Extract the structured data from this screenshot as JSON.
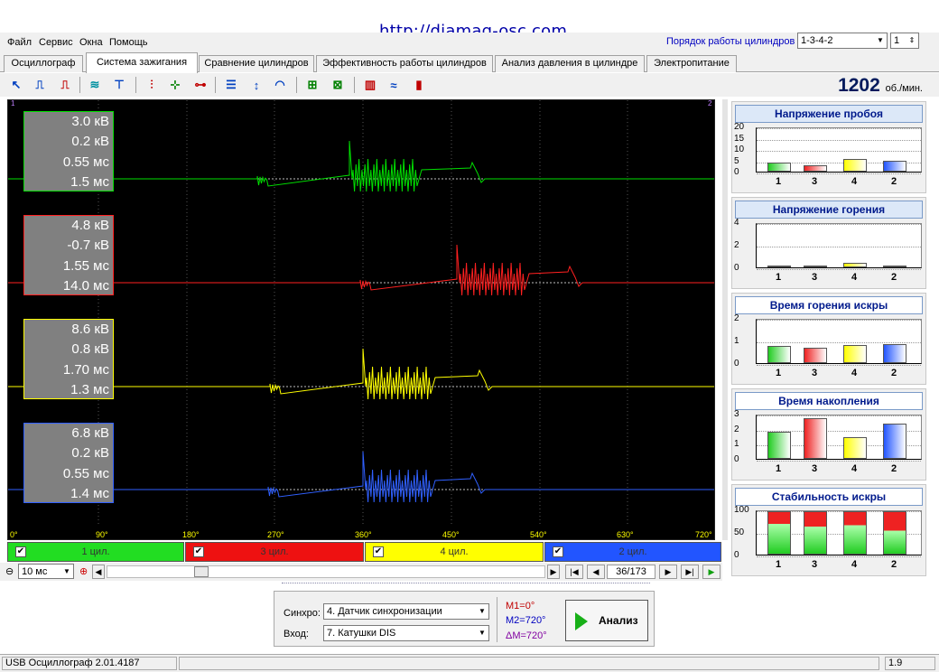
{
  "url": "http://diamag-osc.com",
  "menu": [
    "Файл",
    "Сервис",
    "Окна",
    "Помощь"
  ],
  "cylinder_order": {
    "label": "Порядок работы цилиндров",
    "value": "1-3-4-2",
    "spin": "1"
  },
  "tabs": [
    "Осциллограф",
    "Система зажигания",
    "Сравнение цилиндров",
    "Эффективность работы цилиндров",
    "Анализ давления в цилиндре",
    "Электропитание"
  ],
  "active_tab": 1,
  "rpm": {
    "value": "1202",
    "unit": "об./мин."
  },
  "traces": [
    {
      "color": "#00e000",
      "values": [
        "3.0 кВ",
        "0.2 кВ",
        "0.55 мс",
        "1.5 мс"
      ]
    },
    {
      "color": "#ff2020",
      "values": [
        "4.8 кВ",
        "-0.7 кВ",
        "1.55 мс",
        "14.0 мс"
      ]
    },
    {
      "color": "#ffff00",
      "values": [
        "8.6 кВ",
        "0.8 кВ",
        "1.70 мс",
        "1.3 мс"
      ]
    },
    {
      "color": "#3060ff",
      "values": [
        "6.8 кВ",
        "0.2 кВ",
        "0.55 мс",
        "1.4 мс"
      ]
    }
  ],
  "x_axis": [
    "0°",
    "90°",
    "180°",
    "270°",
    "360°",
    "450°",
    "540°",
    "630°",
    "720°"
  ],
  "markers": [
    "1",
    "2"
  ],
  "channels": [
    {
      "label": "1 цил.",
      "color": "#22dd22"
    },
    {
      "label": "3 цил.",
      "color": "#ee1111"
    },
    {
      "label": "4 цил.",
      "color": "#ffff00"
    },
    {
      "label": "2 цил.",
      "color": "#2255ff"
    }
  ],
  "nav": {
    "timebase": "10 мс",
    "frame": "36/173"
  },
  "panels": [
    {
      "title": "Напряжение пробоя",
      "yticks": [
        "20",
        "15",
        "10",
        "5",
        "0"
      ],
      "ymax": 20,
      "values": [
        4,
        3,
        6,
        5
      ],
      "stacked": false
    },
    {
      "title": "Напряжение горения",
      "yticks": [
        "4",
        "2",
        "0"
      ],
      "ymax": 5,
      "values": [
        0.2,
        0.2,
        0.5,
        0.2
      ],
      "stacked": false
    },
    {
      "title": "Время горения искры",
      "yticks": [
        "2",
        "1",
        "0"
      ],
      "ymax": 2.4,
      "values": [
        0.95,
        0.85,
        1.0,
        1.05
      ],
      "stacked": false
    },
    {
      "title": "Время накопления",
      "yticks": [
        "3",
        "2",
        "1",
        "0"
      ],
      "ymax": 3.2,
      "values": [
        2.0,
        3.0,
        1.6,
        2.6
      ],
      "stacked": false
    },
    {
      "title": "Стабильность искры",
      "yticks": [
        "100",
        "50",
        "0"
      ],
      "ymax": 100,
      "values": [
        72,
        65,
        68,
        55
      ],
      "stacked": true
    }
  ],
  "bar_labels": [
    "1",
    "3",
    "4",
    "2"
  ],
  "bar_colors": [
    "#22cc22",
    "#ee2222",
    "#ffff00",
    "#2255ff"
  ],
  "sync": {
    "label": "Синхро:",
    "value": "4.  Датчик синхронизации"
  },
  "input": {
    "label": "Вход:",
    "value": "7.  Катушки DIS"
  },
  "measurements": {
    "m1": "M1=0°",
    "m2": "M2=720°",
    "dm": "ΔM=720°"
  },
  "analyze_label": "Анализ",
  "status": {
    "app": "USB Осциллограф  2.01.4187",
    "version": "1.9"
  }
}
